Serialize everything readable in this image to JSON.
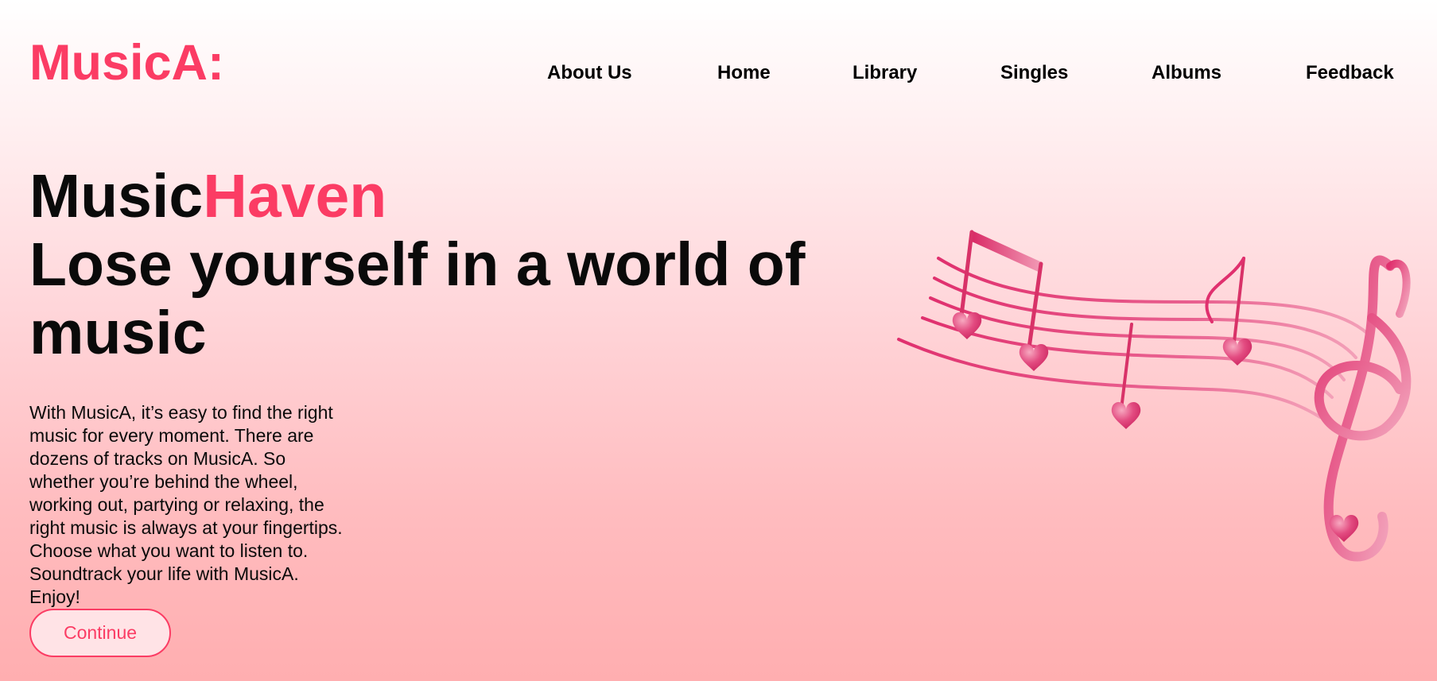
{
  "brand": {
    "logo": "MusicA:"
  },
  "nav": {
    "items": [
      {
        "label": "About Us"
      },
      {
        "label": "Home"
      },
      {
        "label": "Library"
      },
      {
        "label": "Singles"
      },
      {
        "label": "Albums"
      },
      {
        "label": "Feedback"
      }
    ]
  },
  "hero": {
    "title_part1": "Music",
    "title_part2": "Haven",
    "subtitle": "Lose yourself in a world of music",
    "description": "With MusicA, it’s easy to find the right music for every moment. There are dozens of tracks on MusicA. So whether you’re behind the wheel, working out, partying or relaxing, the right music is always at your fingertips. Choose what you want to listen to. Soundtrack your life with MusicA. Enjoy!",
    "continue_label": "Continue"
  },
  "illustration": {
    "icon": "music-staff-hearts-treble-clef-icon"
  },
  "colors": {
    "accent": "#fb3c64",
    "text": "#0a0a0a",
    "background_top": "#ffffff",
    "background_bottom": "#ffaeb0"
  }
}
